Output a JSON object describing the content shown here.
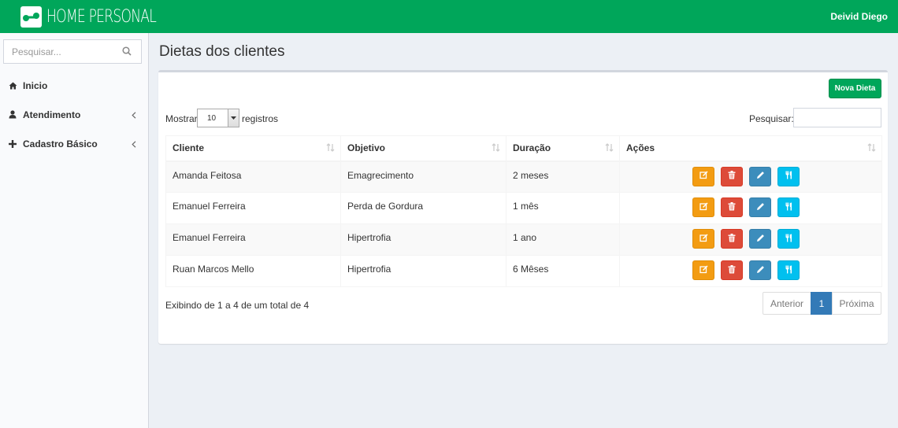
{
  "app": {
    "brand": "HOME PERSONAL",
    "user": "Deivid Diego",
    "colors": {
      "primary": "#00a65a",
      "warning": "#f39c12",
      "danger": "#dd4b39",
      "primary_blue": "#3c8dbc",
      "info": "#00c0ef",
      "pager_active": "#337ab7"
    }
  },
  "sidebar": {
    "search_placeholder": "Pesquisar...",
    "items": [
      {
        "label": "Inicio",
        "icon": "home-icon",
        "has_children": false
      },
      {
        "label": "Atendimento",
        "icon": "user-icon",
        "has_children": true
      },
      {
        "label": "Cadastro Básico",
        "icon": "plus-icon",
        "has_children": true
      }
    ]
  },
  "page": {
    "title": "Dietas dos clientes",
    "new_button": "Nova Dieta"
  },
  "table_controls": {
    "show_label": "Mostrar",
    "show_value": "10",
    "records_label": "registros",
    "filter_label": "Pesquisar:",
    "filter_value": ""
  },
  "table": {
    "columns": [
      "Cliente",
      "Objetivo",
      "Duração",
      "Ações"
    ],
    "rows": [
      {
        "cliente": "Amanda Feitosa",
        "objetivo": "Emagrecimento",
        "duracao": "2 meses"
      },
      {
        "cliente": "Emanuel Ferreira",
        "objetivo": "Perda de Gordura",
        "duracao": "1 mês"
      },
      {
        "cliente": "Emanuel Ferreira",
        "objetivo": "Hipertrofia",
        "duracao": "1 ano"
      },
      {
        "cliente": "Ruan Marcos Mello",
        "objetivo": "Hipertrofia",
        "duracao": "6 Mêses"
      }
    ],
    "action_icons": [
      "edit-square-icon",
      "trash-icon",
      "pencil-icon",
      "cutlery-icon"
    ]
  },
  "footer": {
    "info": "Exibindo de 1 a 4 de um total de 4",
    "prev": "Anterior",
    "current_page": "1",
    "next": "Próxima"
  }
}
